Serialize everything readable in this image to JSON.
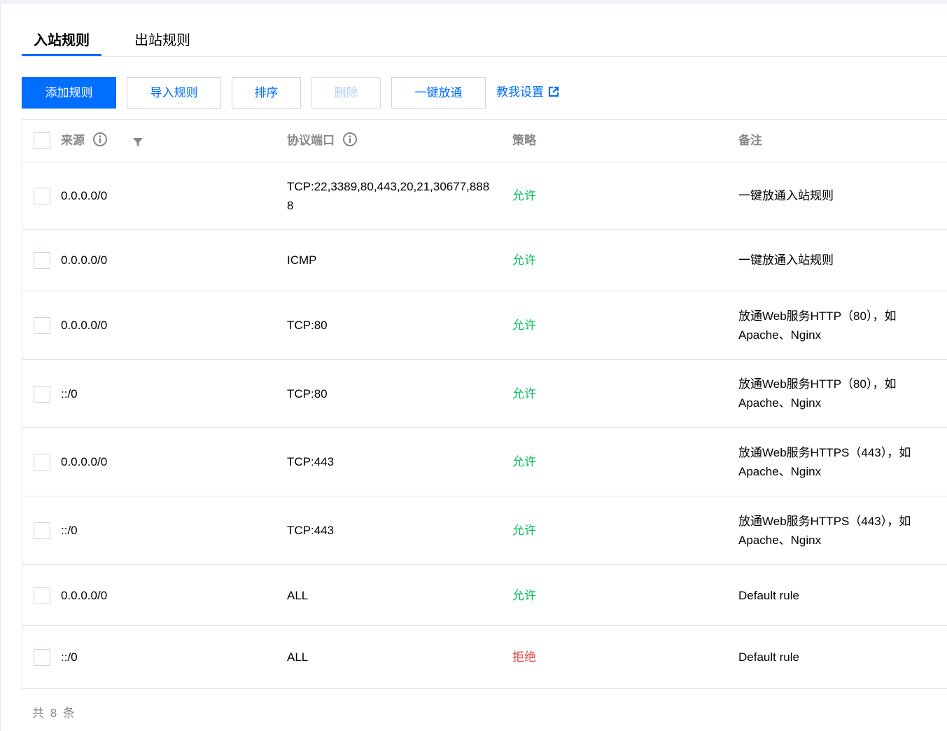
{
  "tabs": [
    {
      "label": "入站规则",
      "active": true
    },
    {
      "label": "出站规则",
      "active": false
    }
  ],
  "toolbar": {
    "add": "添加规则",
    "import": "导入规则",
    "sort": "排序",
    "delete": "删除",
    "open_all": "一键放通",
    "help": "教我设置"
  },
  "table": {
    "headers": {
      "source": "来源",
      "protocol_port": "协议端口",
      "policy": "策略",
      "remark": "备注"
    },
    "rows": [
      {
        "source": "0.0.0.0/0",
        "protocol": "TCP:22,3389,80,443,20,21,30677,8888",
        "policy": "允许",
        "policy_type": "allow",
        "remark": "一键放通入站规则"
      },
      {
        "source": "0.0.0.0/0",
        "protocol": "ICMP",
        "policy": "允许",
        "policy_type": "allow",
        "remark": "一键放通入站规则"
      },
      {
        "source": "0.0.0.0/0",
        "protocol": "TCP:80",
        "policy": "允许",
        "policy_type": "allow",
        "remark": "放通Web服务HTTP（80），如Apache、Nginx"
      },
      {
        "source": "::/0",
        "protocol": "TCP:80",
        "policy": "允许",
        "policy_type": "allow",
        "remark": "放通Web服务HTTP（80），如Apache、Nginx"
      },
      {
        "source": "0.0.0.0/0",
        "protocol": "TCP:443",
        "policy": "允许",
        "policy_type": "allow",
        "remark": "放通Web服务HTTPS（443），如Apache、Nginx"
      },
      {
        "source": "::/0",
        "protocol": "TCP:443",
        "policy": "允许",
        "policy_type": "allow",
        "remark": "放通Web服务HTTPS（443），如Apache、Nginx"
      },
      {
        "source": "0.0.0.0/0",
        "protocol": "ALL",
        "policy": "允许",
        "policy_type": "allow",
        "remark": "Default rule"
      },
      {
        "source": "::/0",
        "protocol": "ALL",
        "policy": "拒绝",
        "policy_type": "deny",
        "remark": "Default rule"
      }
    ]
  },
  "footer": {
    "total": "共 8 条"
  },
  "colors": {
    "primary": "#006eff",
    "allow": "#0abf5b",
    "deny": "#e54545"
  },
  "icons": {
    "header_info": "info-circle-icon",
    "filter": "filter-icon",
    "help_link": "external-link-icon"
  }
}
